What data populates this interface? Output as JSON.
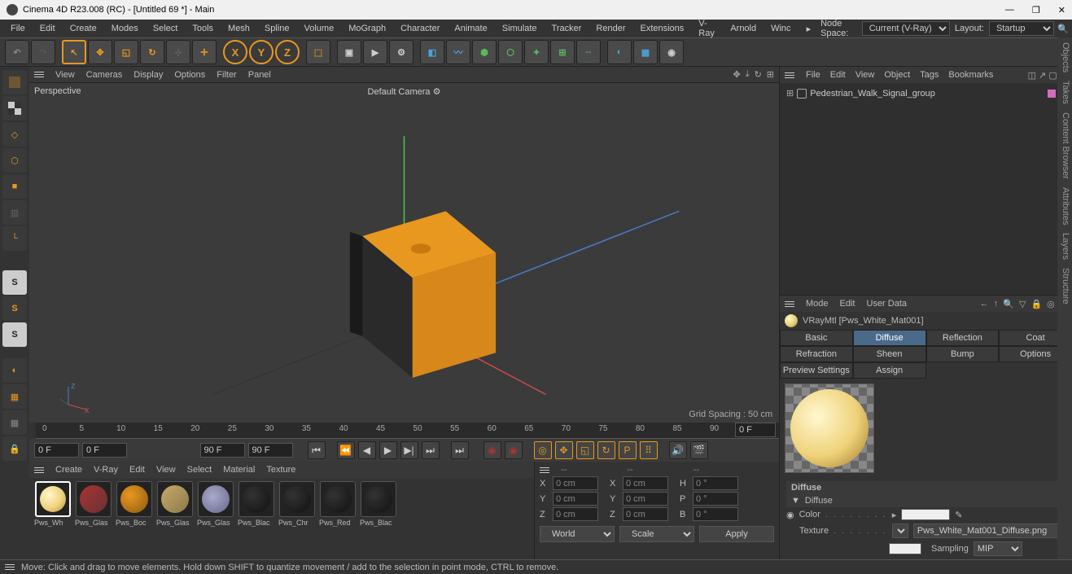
{
  "title": "Cinema 4D R23.008 (RC) - [Untitled 69 *] - Main",
  "menubar": [
    "File",
    "Edit",
    "Create",
    "Modes",
    "Select",
    "Tools",
    "Mesh",
    "Spline",
    "Volume",
    "MoGraph",
    "Character",
    "Animate",
    "Simulate",
    "Tracker",
    "Render",
    "Extensions",
    "V-Ray",
    "Arnold",
    "Winc"
  ],
  "node_space_label": "Node Space:",
  "node_space_value": "Current (V-Ray)",
  "layout_label": "Layout:",
  "layout_value": "Startup",
  "viewport_menu": [
    "View",
    "Cameras",
    "Display",
    "Options",
    "Filter",
    "Panel"
  ],
  "viewport": {
    "view_name": "Perspective",
    "camera": "Default Camera",
    "grid_spacing": "Grid Spacing : 50 cm"
  },
  "timeline": {
    "ruler": [
      "0",
      "5",
      "10",
      "15",
      "20",
      "25",
      "30",
      "35",
      "40",
      "45",
      "50",
      "55",
      "60",
      "65",
      "70",
      "75",
      "80",
      "85",
      "90"
    ],
    "field_right": "0 F",
    "f1": "0 F",
    "f2": "0 F",
    "f3": "90 F",
    "f4": "90 F"
  },
  "material_menu": [
    "Create",
    "V-Ray",
    "Edit",
    "View",
    "Select",
    "Material",
    "Texture"
  ],
  "materials": [
    {
      "name": "Pws_Wh",
      "bg": "radial-gradient(circle at 35% 35%,#fff8d0,#efd27a 55%,#b08a3a)"
    },
    {
      "name": "Pws_Glas",
      "bg": "linear-gradient(135deg,#a33,#633)"
    },
    {
      "name": "Pws_Boc",
      "bg": "radial-gradient(circle at 35% 35%,#e8981f,#8a5a12)"
    },
    {
      "name": "Pws_Glas",
      "bg": "linear-gradient(135deg,#c9a96a,#8a7a4a)"
    },
    {
      "name": "Pws_Glas",
      "bg": "radial-gradient(circle at 40% 40%,#aac,#668)"
    },
    {
      "name": "Pws_Blac",
      "bg": "radial-gradient(circle at 35% 35%,#333,#111)"
    },
    {
      "name": "Pws_Chr",
      "bg": "radial-gradient(circle at 35% 35%,#333,#111)"
    },
    {
      "name": "Pws_Red",
      "bg": "radial-gradient(circle at 35% 35%,#333,#111)"
    },
    {
      "name": "Pws_Blac",
      "bg": "radial-gradient(circle at 35% 35%,#333,#111)"
    }
  ],
  "coords": {
    "x": "0 cm",
    "y": "0 cm",
    "z": "0 cm",
    "x2": "0 cm",
    "y2": "0 cm",
    "z2": "0 cm",
    "h": "0 °",
    "p": "0 °",
    "b": "0 °",
    "world": "World",
    "scale": "Scale",
    "apply": "Apply",
    "dash": "--"
  },
  "obj_menu": [
    "File",
    "Edit",
    "View",
    "Object",
    "Tags",
    "Bookmarks"
  ],
  "obj_tree": {
    "item": "Pedestrian_Walk_Signal_group"
  },
  "attr_menu": [
    "Mode",
    "Edit",
    "User Data"
  ],
  "material_header": "VRayMtl [Pws_White_Mat001]",
  "tabs_row1": [
    "Basic",
    "Diffuse",
    "Reflection",
    "Coat"
  ],
  "tabs_row2": [
    "Refraction",
    "Sheen",
    "Bump",
    "Options"
  ],
  "tabs_row3": [
    "Preview Settings",
    "Assign"
  ],
  "diffuse": {
    "title": "Diffuse",
    "section": "Diffuse",
    "color_lbl": "Color",
    "texture_lbl": "Texture",
    "texture_file": "Pws_White_Mat001_Diffuse.png",
    "sampling_lbl": "Sampling",
    "sampling_val": "MIP"
  },
  "status": "Move: Click and drag to move elements. Hold down SHIFT to quantize movement / add to the selection in point mode, CTRL to remove.",
  "sidetabs": [
    "Objects",
    "Takes",
    "Content Browser",
    "Attributes",
    "Layers",
    "Structure"
  ]
}
